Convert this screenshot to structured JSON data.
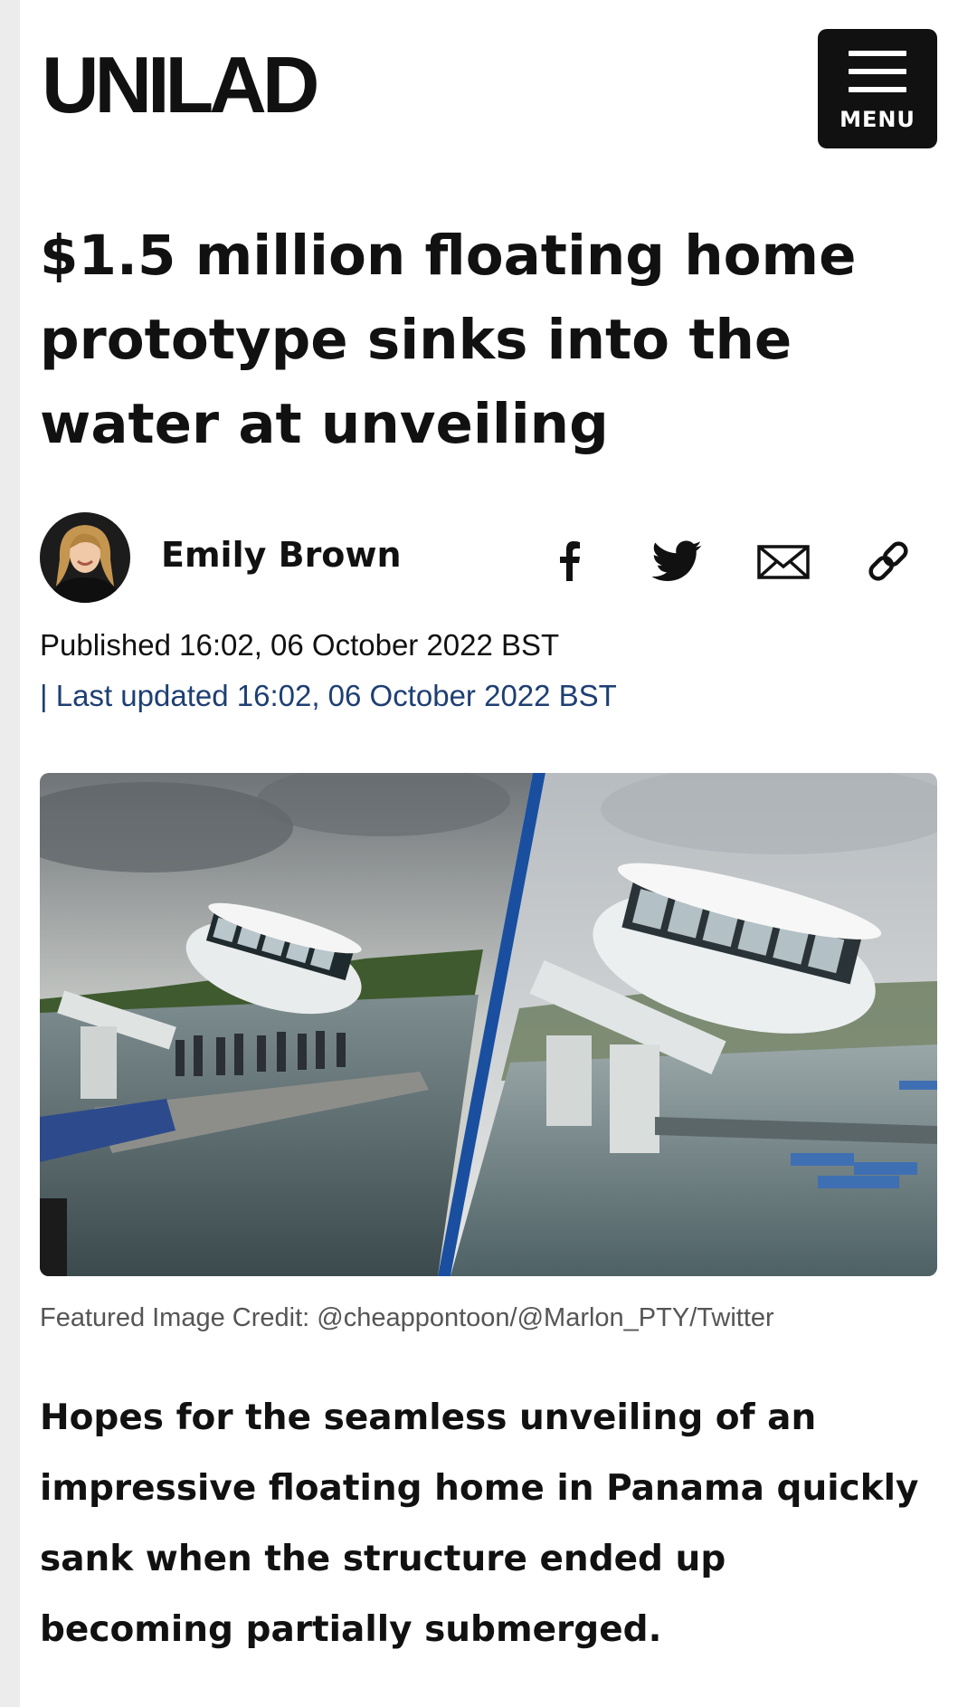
{
  "brand": {
    "logo_text": "UNILAD"
  },
  "header": {
    "menu_label": "MENU"
  },
  "article": {
    "title": "$1.5 million floating home prototype sinks into the water at unveiling",
    "author": "Emily Brown",
    "published": "Published 16:02, 06 October 2022 BST",
    "updated": "| Last updated 16:02, 06 October 2022 BST",
    "image_caption": "Featured Image Credit: @cheappontoon/@Marlon_PTY/Twitter",
    "lead": "Hopes for the seamless unveiling of an impressive floating home in Panama quickly sank when the structure ended up becoming partially submerged."
  },
  "share": {
    "icons": [
      "facebook-icon",
      "twitter-icon",
      "email-icon",
      "link-icon"
    ]
  },
  "colors": {
    "text": "#111111",
    "updated_link": "#1e3f73",
    "caption": "#555555",
    "divider": "#1a4fa0"
  }
}
